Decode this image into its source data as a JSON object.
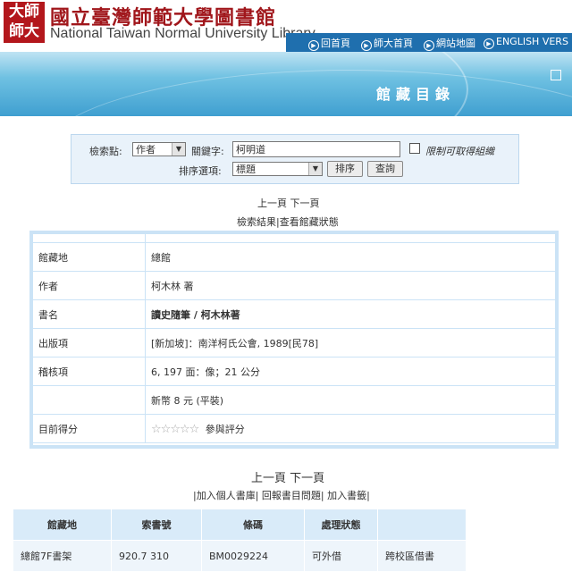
{
  "header": {
    "logo_text": [
      "大師",
      "師大"
    ],
    "library_name_zh": "國立臺灣師範大學圖書館",
    "library_name_en": "National Taiwan Normal University Library",
    "nav": [
      "回首頁",
      "師大首頁",
      "網站地圖",
      "ENGLISH VERS"
    ]
  },
  "banner": {
    "title": "館藏目錄"
  },
  "search": {
    "field_label": "檢索點:",
    "field_value": "作者",
    "keyword_label": "關鍵字:",
    "keyword_value": "柯明道",
    "limit_label": "限制可取得組織",
    "sort_label": "排序選項:",
    "sort_value": "標題",
    "sort_button": "排序",
    "search_button": "查詢"
  },
  "pager_top": {
    "prev": "上一頁",
    "next": "下一頁"
  },
  "links_top": {
    "results": "檢索結果",
    "sep": "|",
    "status": "查看館藏狀態"
  },
  "record": [
    {
      "key": "館藏地",
      "value": "總館"
    },
    {
      "key": "作者",
      "value": "柯木林 著"
    },
    {
      "key": "書名",
      "value": "讀史隨筆 / 柯木林著"
    },
    {
      "key": "出版項",
      "value": "[新加坡]：南洋柯氏公會, 1989[民78]"
    },
    {
      "key": "稽核項",
      "value": "6, 197 面：像；21 公分"
    },
    {
      "key": "",
      "value": "新幣 8 元 (平裝)"
    },
    {
      "key": "目前得分",
      "value": "參與評分"
    }
  ],
  "rating": {
    "stars": 5,
    "filled": 0
  },
  "pager_bottom": {
    "prev": "上一頁",
    "next": "下一頁"
  },
  "links_bottom": {
    "personal": "加入個人書庫",
    "report": "回報書目問題",
    "bookmark": "加入書籤"
  },
  "holdings": {
    "headers": [
      "館藏地",
      "索書號",
      "條碼",
      "處理狀態",
      ""
    ],
    "rows": [
      [
        "總館7F書架",
        "920.7 310",
        "BM0029224",
        "可外借",
        "跨校區借書"
      ]
    ]
  }
}
